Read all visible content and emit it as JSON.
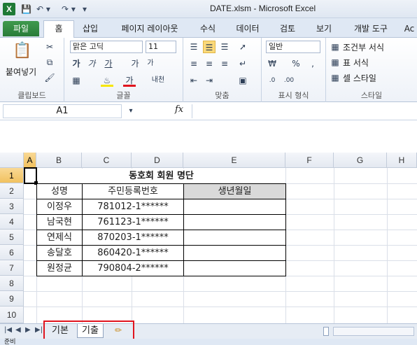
{
  "window": {
    "title": "DATE.xlsm  -  Microsoft Excel",
    "app_icon": "X"
  },
  "ribbon_tabs": [
    "파일",
    "홈",
    "삽입",
    "페이지 레이아웃",
    "수식",
    "데이터",
    "검토",
    "보기",
    "개발 도구",
    "Ac"
  ],
  "ribbon": {
    "clipboard": {
      "label": "클립보드",
      "paste": "붙여넣기"
    },
    "font": {
      "label": "글꼴",
      "font_name": "맑은 고딕",
      "font_size": "11",
      "bold": "가",
      "italic": "가",
      "underline": "가",
      "grow": "가",
      "shrink": "가",
      "color": "가",
      "phonetic": "내천"
    },
    "alignment": {
      "label": "맞춤"
    },
    "number": {
      "label": "표시 형식",
      "format": "일반"
    },
    "styles": {
      "label": "스타일",
      "conditional": "조건부 서식",
      "table": "표 서식",
      "cell": "셀 스타일"
    }
  },
  "formula_bar": {
    "name_box": "A1",
    "fx": "fx",
    "value": ""
  },
  "columns": [
    "A",
    "B",
    "C",
    "D",
    "E",
    "F",
    "G",
    "H"
  ],
  "rows": [
    "1",
    "2",
    "3",
    "4",
    "5",
    "6",
    "7",
    "8",
    "9",
    "10"
  ],
  "sheet": {
    "title": "동호회 회원 명단",
    "headers": [
      "성명",
      "주민등록번호",
      "생년월일"
    ],
    "records": [
      {
        "name": "이정우",
        "id": "781012-1******",
        "birth": ""
      },
      {
        "name": "남국현",
        "id": "761123-1******",
        "birth": ""
      },
      {
        "name": "연제식",
        "id": "870203-1******",
        "birth": ""
      },
      {
        "name": "송달호",
        "id": "860420-1******",
        "birth": ""
      },
      {
        "name": "원정균",
        "id": "790804-2******",
        "birth": ""
      }
    ]
  },
  "sheet_tabs": [
    "기본",
    "기출"
  ],
  "status": {
    "ready": "준비"
  }
}
